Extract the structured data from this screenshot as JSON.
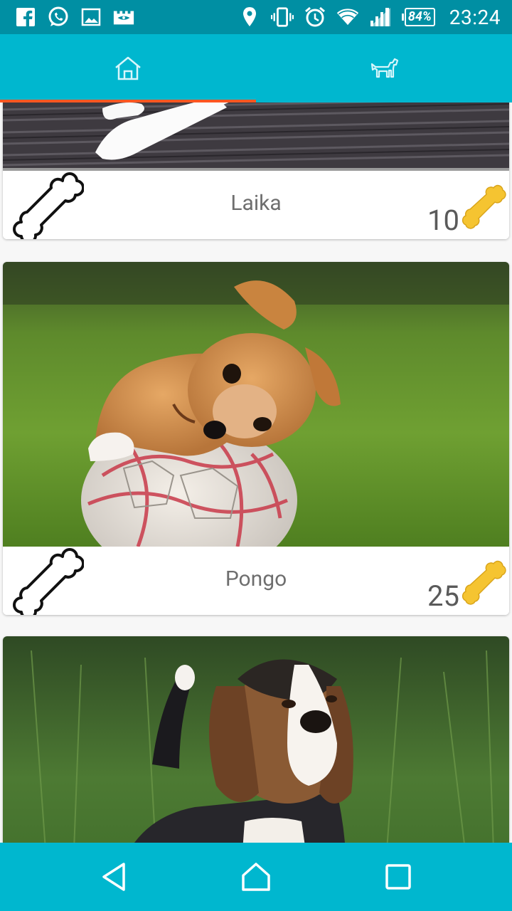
{
  "status_bar": {
    "icons": [
      "facebook-icon",
      "whatsapp-icon",
      "gallery-icon",
      "castle-game-icon",
      "location-icon",
      "vibrate-icon",
      "alarm-icon",
      "wifi-icon",
      "signal-icon"
    ],
    "battery": "84%",
    "time": "23:24"
  },
  "tabs": [
    {
      "icon": "home-icon",
      "selected": true
    },
    {
      "icon": "dog-icon",
      "selected": false
    }
  ],
  "colors": {
    "status_bar": "#008fa3",
    "primary": "#00b7cf",
    "indicator": "#ff5722",
    "bone_gold": "#f5c431"
  },
  "dogs": [
    {
      "name": "Laika",
      "count": "10"
    },
    {
      "name": "Pongo",
      "count": "25"
    },
    {
      "name": "",
      "count": ""
    }
  ],
  "nav": [
    "back-icon",
    "home-icon",
    "recents-icon"
  ]
}
